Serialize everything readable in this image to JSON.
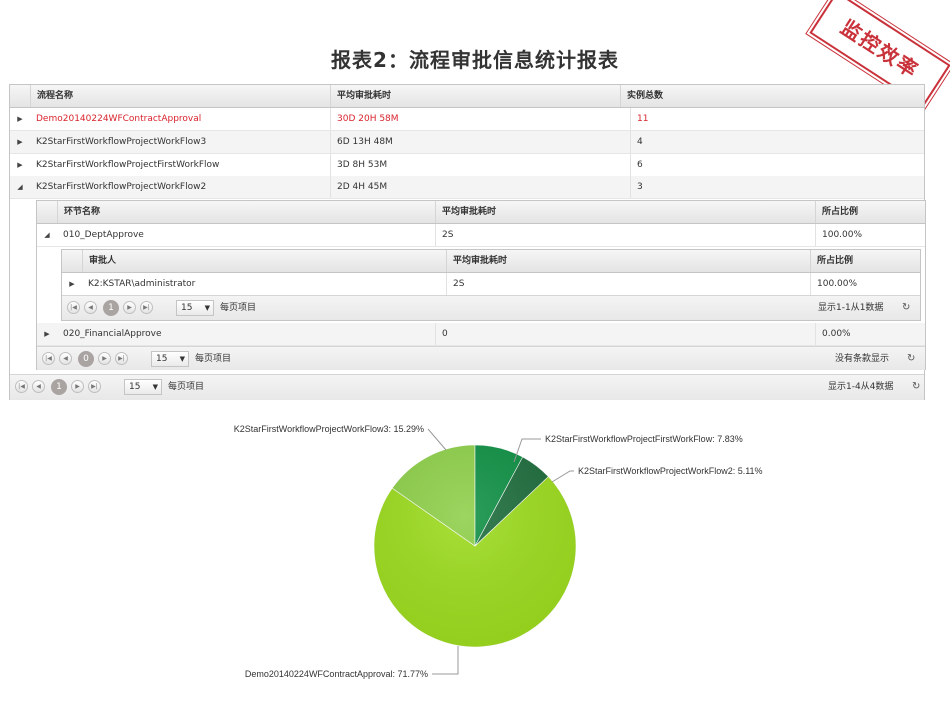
{
  "title": "报表2：流程审批信息统计报表",
  "stamp": "监控效率",
  "main_grid": {
    "columns": [
      "流程名称",
      "平均审批耗时",
      "实例总数"
    ],
    "rows": [
      {
        "name": "Demo20140224WFContractApproval",
        "avg": "30D 20H 58M",
        "count": "11",
        "highlight": true
      },
      {
        "name": "K2StarFirstWorkflowProjectWorkFlow3",
        "avg": "6D 13H 48M",
        "count": "4"
      },
      {
        "name": "K2StarFirstWorkflowProjectFirstWorkFlow",
        "avg": "3D 8H 53M",
        "count": "6"
      },
      {
        "name": "K2StarFirstWorkflowProjectWorkFlow2",
        "avg": "2D 4H 45M",
        "count": "3",
        "expanded": true
      }
    ],
    "pager": {
      "page": "1",
      "page_size": "15",
      "per_page_label": "每页项目",
      "info": "显示1-4从4数据"
    }
  },
  "step_grid": {
    "columns": [
      "环节名称",
      "平均审批耗时",
      "所占比例"
    ],
    "rows": [
      {
        "name": "010_DeptApprove",
        "avg": "2S",
        "pct": "100.00%"
      },
      {
        "name": "020_FinancialApprove",
        "avg": "0",
        "pct": "0.00%"
      }
    ],
    "pager": {
      "page": "0",
      "page_size": "15",
      "per_page_label": "每页项目",
      "info": "没有条款显示"
    }
  },
  "approver_grid": {
    "columns": [
      "审批人",
      "平均审批耗时",
      "所占比例"
    ],
    "rows": [
      {
        "name": "K2:KSTAR\\administrator",
        "avg": "2S",
        "pct": "100.00%"
      }
    ],
    "pager": {
      "page": "1",
      "page_size": "15",
      "per_page_label": "每页项目",
      "info": "显示1-1从1数据"
    }
  },
  "icons": {
    "first": "first-page-icon",
    "prev": "prev-page-icon",
    "next": "next-page-icon",
    "last": "last-page-icon",
    "refresh": "refresh-icon",
    "expand": "expand-arrow-icon",
    "collapse": "collapse-arrow-icon"
  },
  "chart_data": {
    "type": "pie",
    "slices": [
      {
        "label": "Demo20140224WFContractApproval: 71.77%",
        "value": 71.77,
        "color": "#9ddc1f"
      },
      {
        "label": "K2StarFirstWorkflowProjectWorkFlow3: 15.29%",
        "value": 15.29,
        "color": "#8fd04a"
      },
      {
        "label": "K2StarFirstWorkflowProjectFirstWorkFlow: 7.83%",
        "value": 7.83,
        "color": "#0f9145"
      },
      {
        "label": "K2StarFirstWorkflowProjectWorkFlow2: 5.11%",
        "value": 5.11,
        "color": "#1f6e3e"
      }
    ]
  },
  "colors": {
    "highlight_text": "#d9242e",
    "stamp": "#c9323a"
  }
}
